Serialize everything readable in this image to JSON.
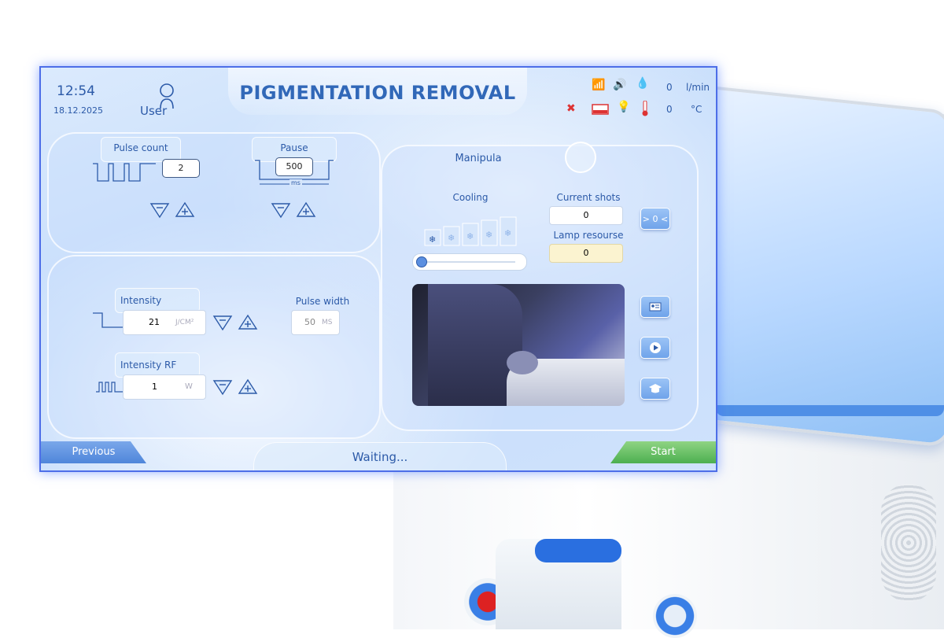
{
  "header": {
    "time": "12:54",
    "date": "18.12.2025",
    "user_label": "User",
    "title": "PIGMENTATION REMOVAL",
    "flow_value": "0",
    "flow_unit": "l/min",
    "temp_value": "0",
    "temp_unit": "°C"
  },
  "pulse_count": {
    "label": "Pulse count",
    "value": "2"
  },
  "pause": {
    "label": "Pause",
    "value": "500",
    "unit": "ms"
  },
  "intensity": {
    "label": "Intensity",
    "value": "21",
    "unit": "J/CM²"
  },
  "pulse_width": {
    "label": "Pulse width",
    "value": "50",
    "unit": "MS"
  },
  "intensity_rf": {
    "label": "Intensity RF",
    "value": "1",
    "unit": "W"
  },
  "manipula": {
    "label": "Manipula"
  },
  "cooling": {
    "label": "Cooling",
    "level": 0
  },
  "current_shots": {
    "label": "Current shots",
    "value": "0"
  },
  "reset_button": {
    "label": "> 0 <"
  },
  "lamp_resource": {
    "label": "Lamp resourse",
    "value": "0"
  },
  "footer": {
    "previous_label": "Previous",
    "status": "Waiting...",
    "start_label": "Start"
  },
  "colors": {
    "accent": "#3168b8",
    "start": "#4caf50",
    "previous": "#5b8fe0"
  }
}
